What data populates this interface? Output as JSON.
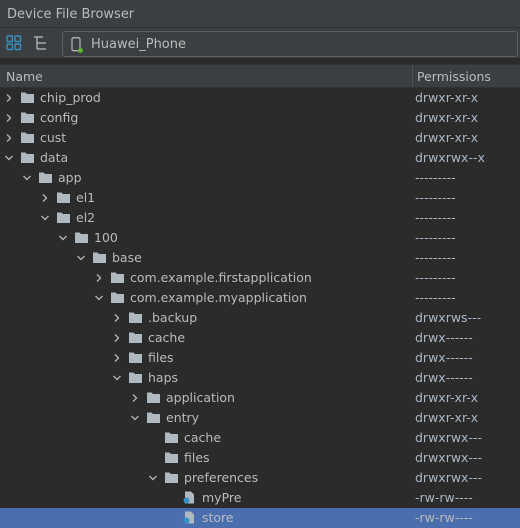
{
  "window": {
    "title": "Device File Browser"
  },
  "toolbar": {
    "device_name": "Huawei_Phone",
    "icons": [
      "group-icon",
      "tree-icon",
      "phone-icon"
    ]
  },
  "table": {
    "columns": [
      "Name",
      "Permissions"
    ],
    "rows": [
      {
        "name": "chip_prod",
        "permissions": "drwxr-xr-x",
        "depth": 0,
        "type": "folder",
        "expanded": false
      },
      {
        "name": "config",
        "permissions": "drwxr-xr-x",
        "depth": 0,
        "type": "folder",
        "expanded": false
      },
      {
        "name": "cust",
        "permissions": "drwxr-xr-x",
        "depth": 0,
        "type": "folder",
        "expanded": false
      },
      {
        "name": "data",
        "permissions": "drwxrwx--x",
        "depth": 0,
        "type": "folder",
        "expanded": true
      },
      {
        "name": "app",
        "permissions": "---------",
        "depth": 1,
        "type": "folder",
        "expanded": true
      },
      {
        "name": "el1",
        "permissions": "---------",
        "depth": 2,
        "type": "folder",
        "expanded": false
      },
      {
        "name": "el2",
        "permissions": "---------",
        "depth": 2,
        "type": "folder",
        "expanded": true
      },
      {
        "name": "100",
        "permissions": "---------",
        "depth": 3,
        "type": "folder",
        "expanded": true
      },
      {
        "name": "base",
        "permissions": "---------",
        "depth": 4,
        "type": "folder",
        "expanded": true
      },
      {
        "name": "com.example.firstapplication",
        "permissions": "---------",
        "depth": 5,
        "type": "folder",
        "expanded": false
      },
      {
        "name": "com.example.myapplication",
        "permissions": "---------",
        "depth": 5,
        "type": "folder",
        "expanded": true
      },
      {
        "name": ".backup",
        "permissions": "drwxrws---",
        "depth": 6,
        "type": "folder",
        "expanded": false
      },
      {
        "name": "cache",
        "permissions": "drwx------",
        "depth": 6,
        "type": "folder",
        "expanded": false
      },
      {
        "name": "files",
        "permissions": "drwx------",
        "depth": 6,
        "type": "folder",
        "expanded": false
      },
      {
        "name": "haps",
        "permissions": "drwx------",
        "depth": 6,
        "type": "folder",
        "expanded": true
      },
      {
        "name": "application",
        "permissions": "drwxr-xr-x",
        "depth": 7,
        "type": "folder",
        "expanded": false
      },
      {
        "name": "entry",
        "permissions": "drwxr-xr-x",
        "depth": 7,
        "type": "folder",
        "expanded": true
      },
      {
        "name": "cache",
        "permissions": "drwxrwx---",
        "depth": 8,
        "type": "folder",
        "leaf": true
      },
      {
        "name": "files",
        "permissions": "drwxrwx---",
        "depth": 8,
        "type": "folder",
        "leaf": true
      },
      {
        "name": "preferences",
        "permissions": "drwxrwx---",
        "depth": 8,
        "type": "folder",
        "expanded": true
      },
      {
        "name": "myPre",
        "permissions": "-rw-rw----",
        "depth": 9,
        "type": "file",
        "leaf": true
      },
      {
        "name": "store",
        "permissions": "-rw-rw----",
        "depth": 9,
        "type": "file",
        "leaf": true,
        "selected": true
      }
    ]
  },
  "colors": {
    "background": "#2b2b2b",
    "panel": "#3c3f41",
    "selection": "#4b6eaf",
    "folder": "#aeb9c0",
    "accent_blue": "#3592c4",
    "device_dot": "#5fb832"
  }
}
